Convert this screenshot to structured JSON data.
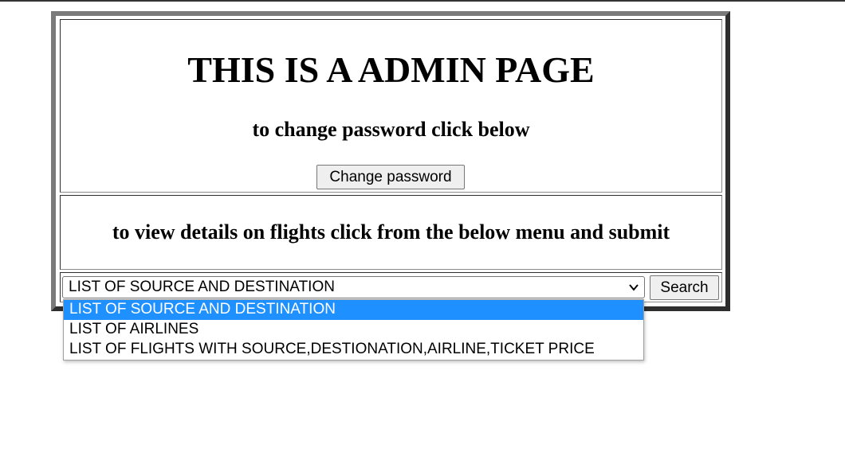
{
  "header": {
    "title": "THIS IS A ADMIN PAGE",
    "password_prompt": "to change password click below",
    "change_password_label": "Change password"
  },
  "flights": {
    "prompt": "to view details on flights click from the below menu and submit",
    "select_value": "LIST OF SOURCE AND DESTINATION",
    "search_label": "Search",
    "options": [
      "LIST OF SOURCE AND DESTINATION",
      "LIST OF AIRLINES",
      "LIST OF FLIGHTS WITH SOURCE,DESTIONATION,AIRLINE,TICKET PRICE"
    ],
    "highlighted_index": 0
  },
  "colors": {
    "highlight": "#1e90ff",
    "button_bg": "#efefef"
  },
  "icons": {
    "select_arrow": "chevron-down-icon"
  }
}
